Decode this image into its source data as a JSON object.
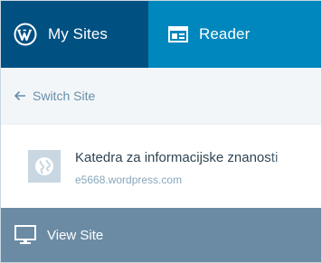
{
  "masterbar": {
    "my_sites_label": "My Sites",
    "reader_label": "Reader",
    "my_sites_icon": "wordpress-logo-icon",
    "reader_icon": "reader-icon"
  },
  "switch_site": {
    "label": "Switch Site",
    "icon": "arrow-left-icon"
  },
  "site": {
    "title": "Katedra za informacijske znanosti",
    "domain": "e5668.wordpress.com",
    "icon": "globe-icon"
  },
  "view_site": {
    "label": "View Site",
    "icon": "computer-icon"
  },
  "colors": {
    "masterbar": "#0087be",
    "masterbar_active": "#005082",
    "switch_bg": "#f3f6f8",
    "view_site_bg": "#6b8ba4"
  }
}
